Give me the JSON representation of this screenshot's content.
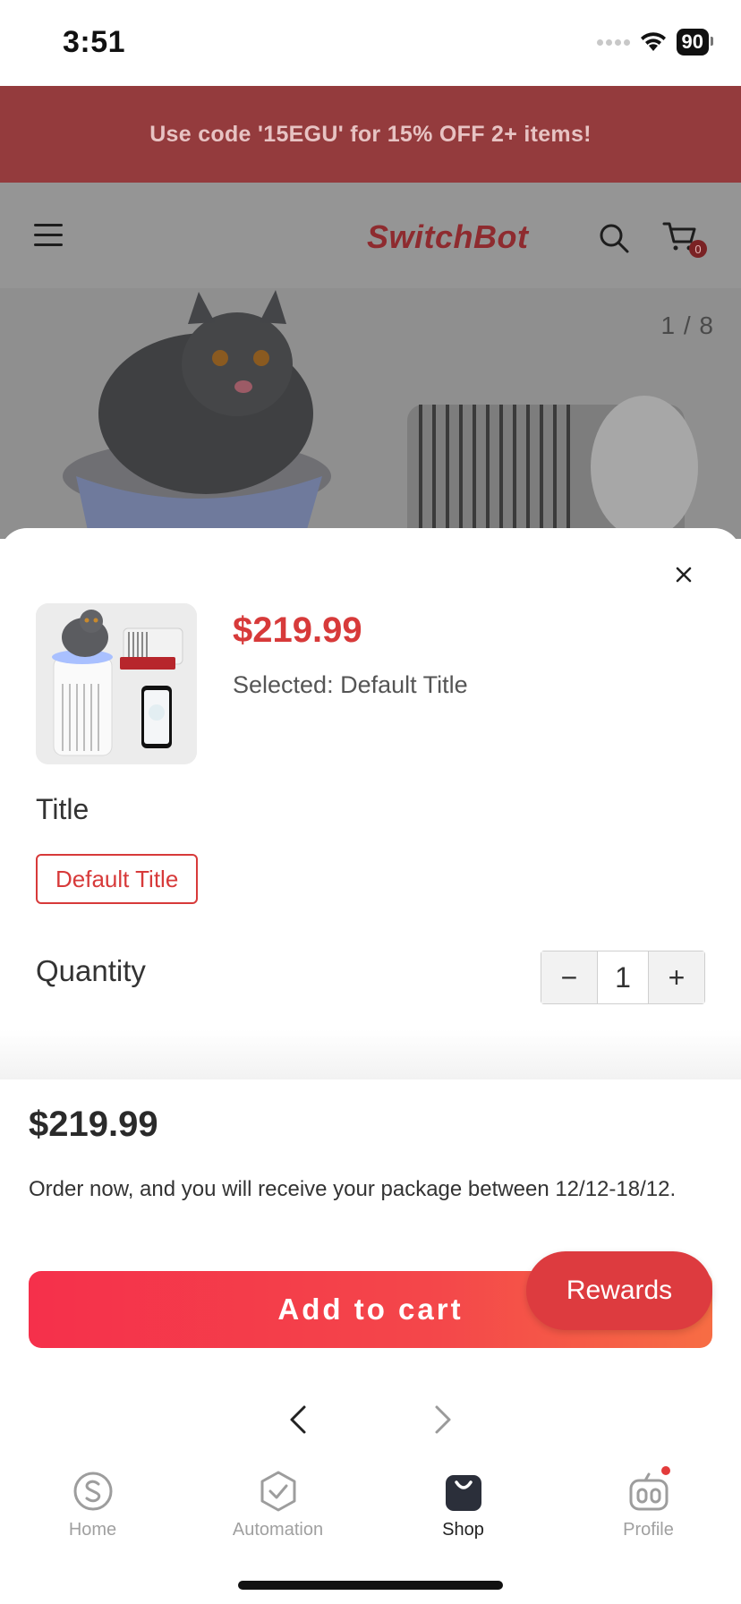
{
  "status_bar": {
    "time": "3:51",
    "battery": "90"
  },
  "promo": {
    "text": "Use code '15EGU' for 15% OFF 2+ items!"
  },
  "header": {
    "brand": "SwitchBot",
    "cart_count": "0"
  },
  "hero": {
    "counter": "1 / 8"
  },
  "sheet": {
    "price": "$219.99",
    "selected": "Selected: Default Title",
    "option_label": "Title",
    "option_value": "Default Title",
    "quantity_label": "Quantity",
    "quantity_minus": "−",
    "quantity_value": "1",
    "quantity_plus": "+"
  },
  "purchase": {
    "total": "$219.99",
    "delivery": "Order now, and you will receive your package between 12/12-18/12.",
    "add_to_cart": "Add to cart",
    "rewards": "Rewards"
  },
  "tabs": [
    {
      "label": "Home",
      "icon": "s-circle-icon"
    },
    {
      "label": "Automation",
      "icon": "check-shield-icon"
    },
    {
      "label": "Shop",
      "icon": "shopping-bag-icon"
    },
    {
      "label": "Profile",
      "icon": "robot-icon"
    }
  ],
  "colors": {
    "accent": "#d73a3a",
    "promo_bg": "#943b3d",
    "rewards": "#dd3b3f"
  }
}
